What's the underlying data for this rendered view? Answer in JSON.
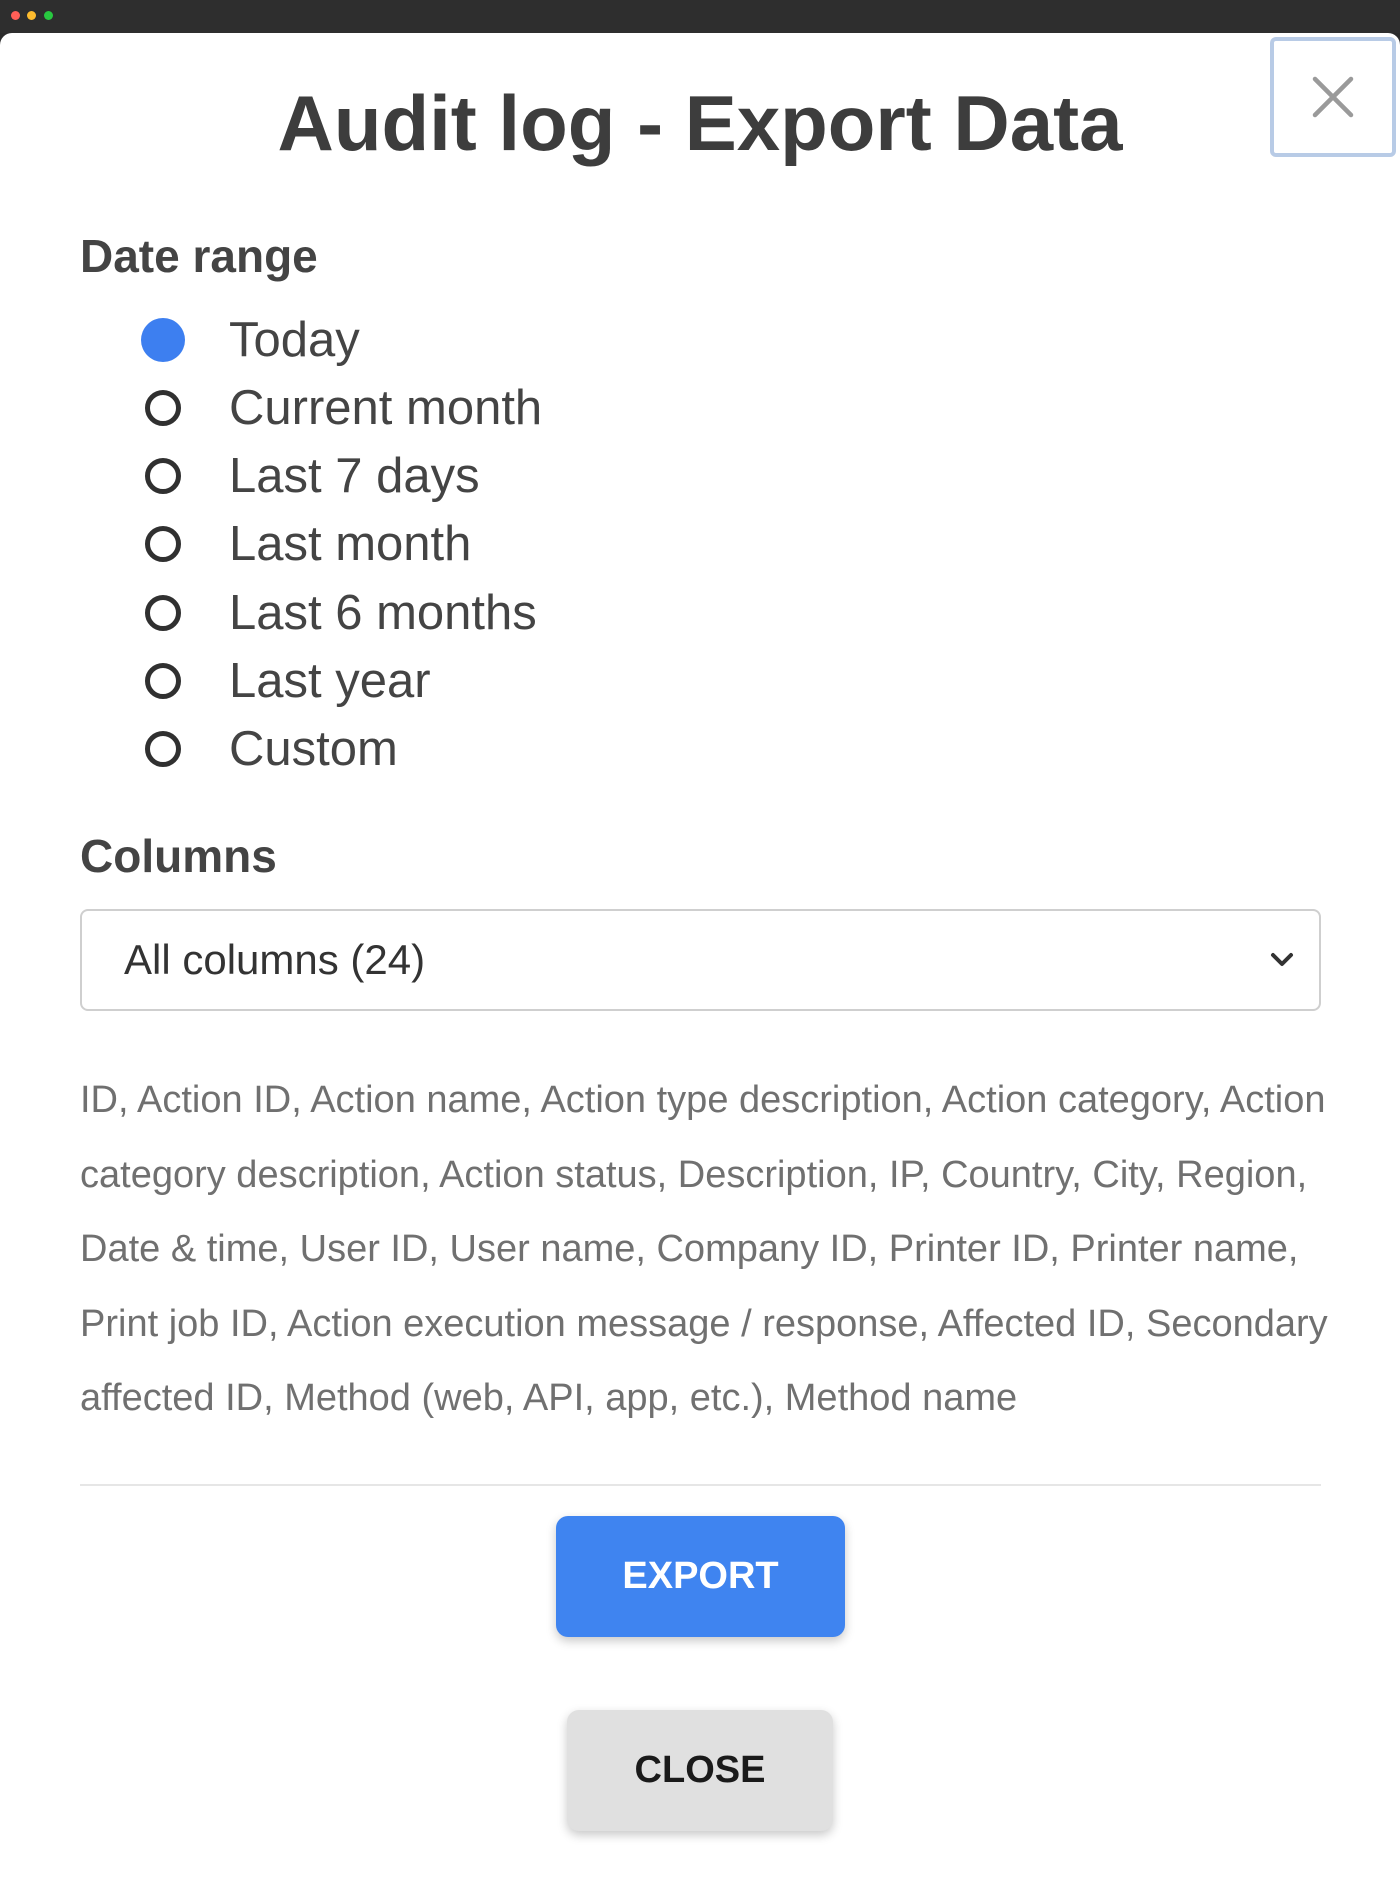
{
  "dialog": {
    "title": "Audit log - Export Data",
    "close_icon": "close-icon"
  },
  "date_range": {
    "label": "Date range",
    "selected": "Today",
    "options": [
      {
        "label": "Today",
        "checked": true
      },
      {
        "label": "Current month",
        "checked": false
      },
      {
        "label": "Last 7 days",
        "checked": false
      },
      {
        "label": "Last month",
        "checked": false
      },
      {
        "label": "Last 6 months",
        "checked": false
      },
      {
        "label": "Last year",
        "checked": false
      },
      {
        "label": "Custom",
        "checked": false
      }
    ]
  },
  "columns": {
    "label": "Columns",
    "selected_value": "All columns (24)",
    "description": "ID, Action ID, Action name, Action type description, Action category, Action category description, Action status, Description, IP, Country, City, Region, Date & time, User ID, User name, Company ID, Printer ID, Printer name, Print job ID, Action execution message / response, Affected ID, Secondary affected ID, Method (web, API, app, etc.), Method name"
  },
  "buttons": {
    "export_label": "EXPORT",
    "close_label": "CLOSE"
  },
  "colors": {
    "accent": "#3f84f0",
    "close_button_bg": "#e0e0e0"
  }
}
